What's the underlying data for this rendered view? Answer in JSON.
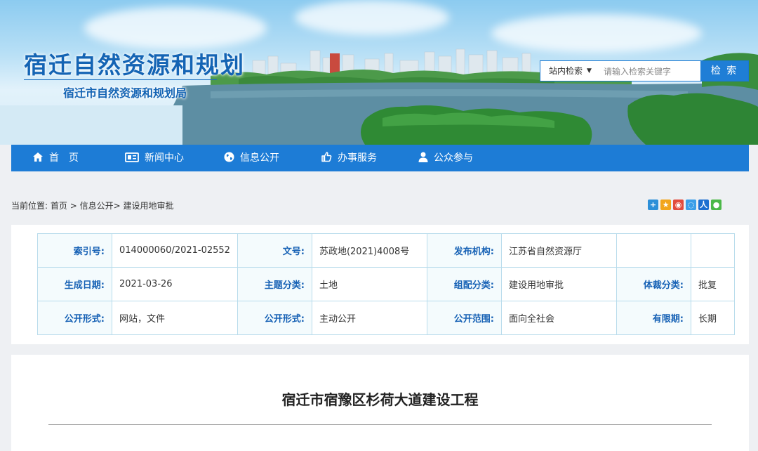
{
  "header": {
    "title": "宿迁自然资源和规划",
    "subtitle": "宿迁市自然资源和规划局"
  },
  "search": {
    "scope_label": "站内检索",
    "placeholder": "请输入检索关键字",
    "button_label": "检 索"
  },
  "nav": {
    "items": [
      {
        "label": "首　页",
        "icon": "home-icon"
      },
      {
        "label": "新闻中心",
        "icon": "newspaper-icon"
      },
      {
        "label": "信息公开",
        "icon": "globe-icon"
      },
      {
        "label": "办事服务",
        "icon": "thumbs-up-icon"
      },
      {
        "label": "公众参与",
        "icon": "user-icon"
      }
    ]
  },
  "breadcrumb": {
    "prefix": "当前位置:",
    "home": "首页",
    "sep1": ">",
    "section": "信息公开>",
    "current": "建设用地审批"
  },
  "share": {
    "icons": [
      "plus-share-icon",
      "qzone-icon",
      "weibo-icon",
      "tencent-weibo-icon",
      "renren-icon",
      "wechat-icon"
    ],
    "colors": [
      "#2c8fd8",
      "#f2a51a",
      "#e24b3c",
      "#3b9ee8",
      "#1d6fd0",
      "#4cb848"
    ]
  },
  "meta": {
    "index_no_label": "索引号:",
    "index_no": "014000060/2021-02552",
    "doc_no_label": "文号:",
    "doc_no": "苏政地(2021)4008号",
    "publisher_label": "发布机构:",
    "publisher": "江苏省自然资源厅",
    "date_label": "生成日期:",
    "date": "2021-03-26",
    "topic_label": "主题分类:",
    "topic": "土地",
    "group_label": "组配分类:",
    "group": "建设用地审批",
    "genre_label": "体裁分类:",
    "genre": "批复",
    "form_label": "公开形式:",
    "form": "网站，文件",
    "mode_label": "公开形式:",
    "mode": "主动公开",
    "scope_label": "公开范围:",
    "scope": "面向全社会",
    "validity_label": "有限期:",
    "validity": "长期"
  },
  "article": {
    "title": "宿迁市宿豫区杉荷大道建设工程"
  }
}
